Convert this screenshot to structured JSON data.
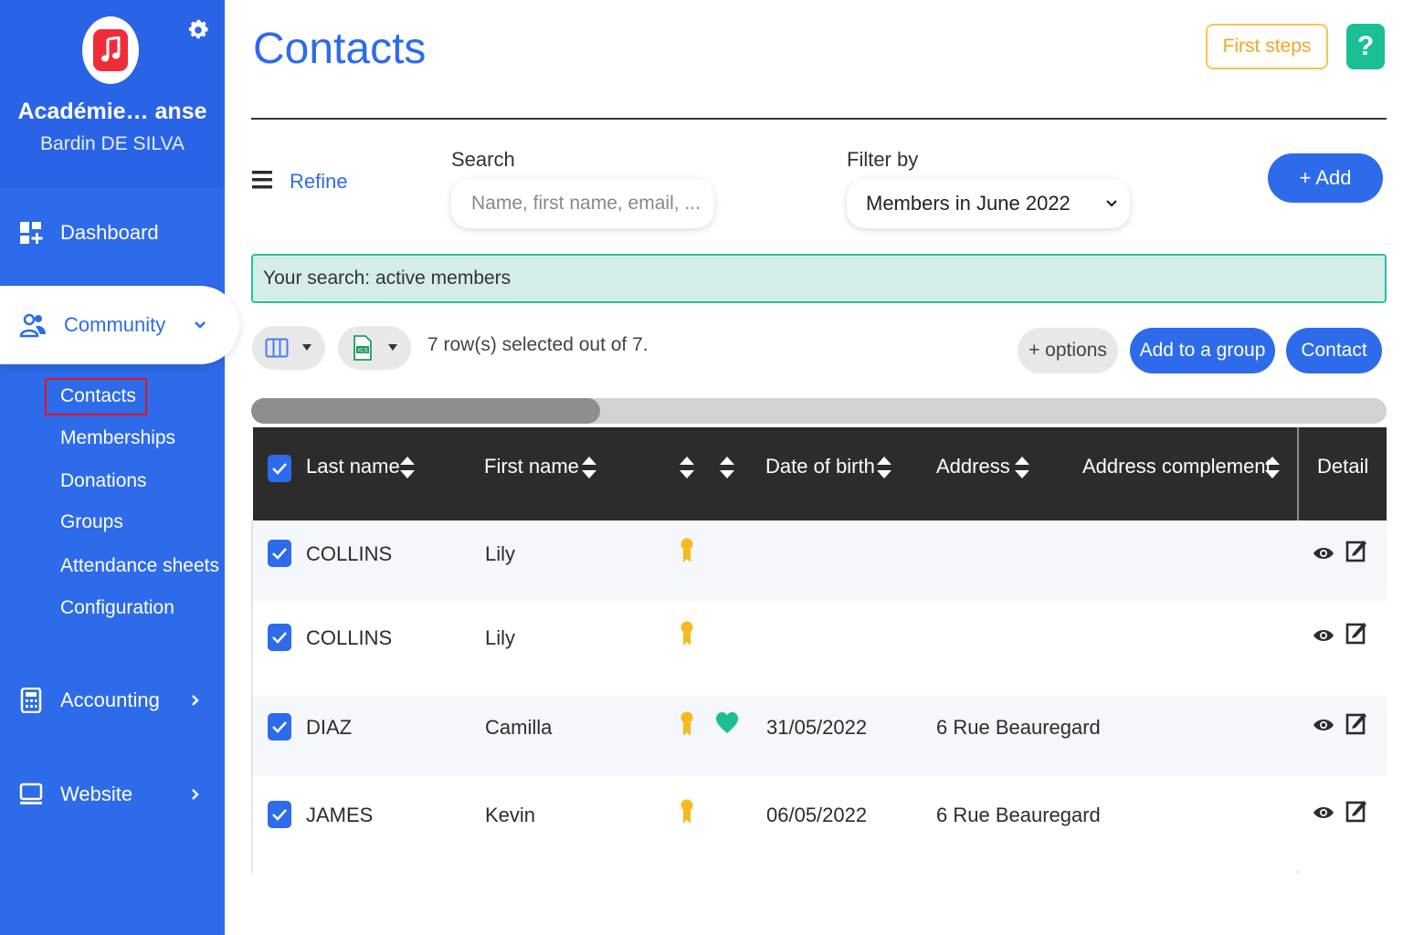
{
  "sidebar": {
    "org_name": "Académie… anse",
    "user_name": "Bardin DE SILVA",
    "nav": {
      "dashboard": "Dashboard",
      "community": "Community",
      "accounting": "Accounting",
      "website": "Website"
    },
    "community_items": [
      "Contacts",
      "Memberships",
      "Donations",
      "Groups",
      "Attendance sheets",
      "Configuration"
    ],
    "active_item": "Contacts"
  },
  "header": {
    "title": "Contacts",
    "first_steps": "First steps",
    "help": "?"
  },
  "filters": {
    "refine": "Refine",
    "search_label": "Search",
    "search_placeholder": "Name, first name, email, ...",
    "filter_label": "Filter by",
    "filter_value": "Members in June 2022",
    "add_button": "+ Add"
  },
  "banner": "Your search: active members",
  "toolbar": {
    "selection_text": "7 row(s) selected out of 7.",
    "options": "+ options",
    "add_to_group": "Add to a group",
    "contact": "Contact"
  },
  "table": {
    "columns": [
      "Last name",
      "First name",
      "Date of birth",
      "Address",
      "Address complement",
      "Detail"
    ],
    "rows": [
      {
        "last_name": "COLLINS",
        "first_name": "Lily",
        "member": true,
        "donor": false,
        "dob": "",
        "address": "",
        "address_complement": ""
      },
      {
        "last_name": "COLLINS",
        "first_name": "Lily",
        "member": true,
        "donor": false,
        "dob": "",
        "address": "",
        "address_complement": ""
      },
      {
        "last_name": "DIAZ",
        "first_name": "Camilla",
        "member": true,
        "donor": true,
        "dob": "31/05/2022",
        "address": "6 Rue Beauregard",
        "address_complement": ""
      },
      {
        "last_name": "JAMES",
        "first_name": "Kevin",
        "member": true,
        "donor": false,
        "dob": "06/05/2022",
        "address": "6 Rue Beauregard",
        "address_complement": ""
      }
    ]
  },
  "colors": {
    "accent": "#2d6bea",
    "banner_bg": "#d4ede8",
    "banner_border": "#2bbf9a",
    "help": "#1bbf96",
    "first_steps": "#f2a623",
    "header_bg": "#2c2c2c",
    "ribbon": "#f5b921",
    "heart": "#1bbf96"
  }
}
